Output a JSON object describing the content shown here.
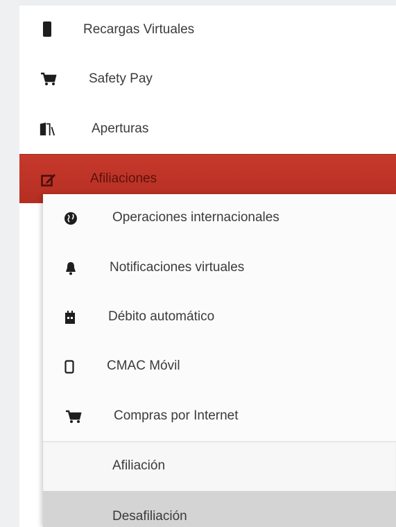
{
  "main_menu": {
    "items": [
      {
        "label": "Recargas Virtuales",
        "icon": "mobile-phone-icon"
      },
      {
        "label": "Safety Pay",
        "icon": "shopping-cart-icon"
      },
      {
        "label": "Aperturas",
        "icon": "open-door-icon"
      },
      {
        "label": "Afiliaciones",
        "icon": "edit-icon",
        "active": true
      }
    ]
  },
  "afiliaciones_submenu": {
    "items": [
      {
        "label": "Operaciones internacionales",
        "icon": "globe-icon"
      },
      {
        "label": "Notificaciones virtuales",
        "icon": "bell-icon"
      },
      {
        "label": "Débito automático",
        "icon": "calendar-icon"
      },
      {
        "label": "CMAC Móvil",
        "icon": "mobile-phone-icon"
      },
      {
        "label": "Compras por Internet",
        "icon": "shopping-cart-icon"
      }
    ]
  },
  "compras_submenu": {
    "items": [
      {
        "label": "Afiliación"
      },
      {
        "label": "Desafiliación",
        "hovered": true
      }
    ]
  },
  "colors": {
    "active_background": "#c0392b",
    "hover_background": "#d4d4d4",
    "panel_background": "#ffffff"
  }
}
